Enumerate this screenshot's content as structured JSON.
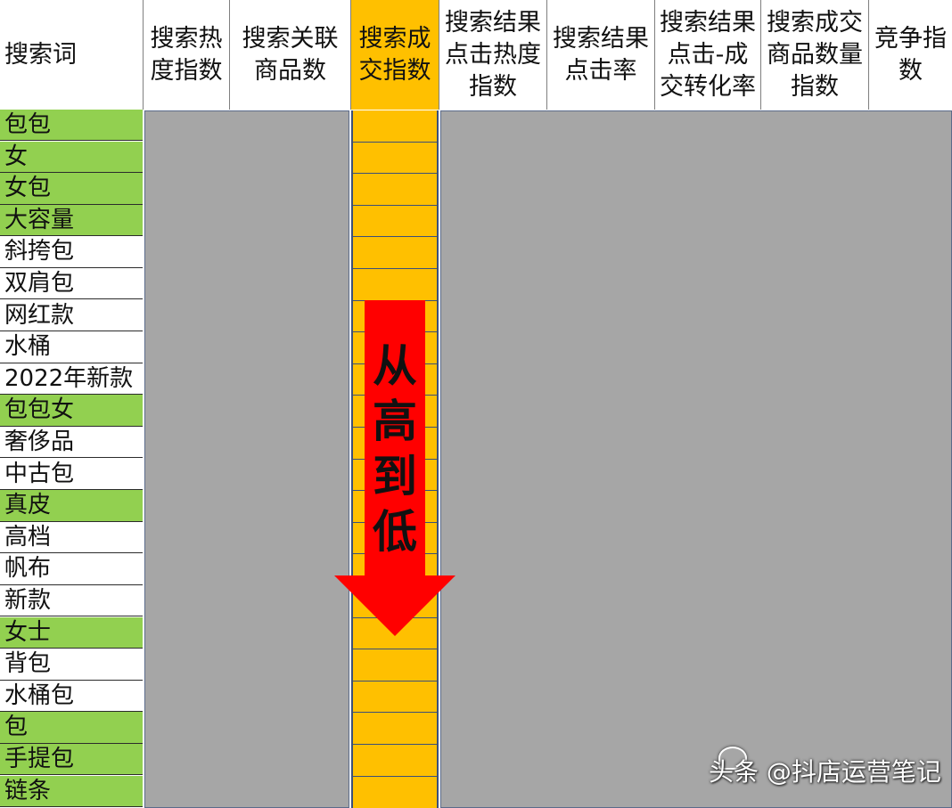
{
  "header": {
    "keyword": "搜索词",
    "columns": [
      "搜索热\n度指数",
      "搜索关联\n商品数",
      "搜索成\n交指数",
      "搜索结果\n点击热度\n指数",
      "搜索结果\n点击率",
      "搜索结果\n点击-成\n交转化率",
      "搜索成交\n商品数量\n指数",
      "竞争指\n数"
    ]
  },
  "keywords": [
    {
      "text": "包包",
      "highlight": true
    },
    {
      "text": "女",
      "highlight": true
    },
    {
      "text": "女包",
      "highlight": true
    },
    {
      "text": "大容量",
      "highlight": true
    },
    {
      "text": "斜挎包",
      "highlight": false
    },
    {
      "text": "双肩包",
      "highlight": false
    },
    {
      "text": "网红款",
      "highlight": false
    },
    {
      "text": "水桶",
      "highlight": false
    },
    {
      "text": "2022年新款",
      "highlight": false
    },
    {
      "text": "包包女",
      "highlight": true
    },
    {
      "text": "奢侈品",
      "highlight": false
    },
    {
      "text": "中古包",
      "highlight": false
    },
    {
      "text": "真皮",
      "highlight": true
    },
    {
      "text": "高档",
      "highlight": false
    },
    {
      "text": "帆布",
      "highlight": false
    },
    {
      "text": "新款",
      "highlight": false
    },
    {
      "text": "女士",
      "highlight": true
    },
    {
      "text": "背包",
      "highlight": false
    },
    {
      "text": "水桶包",
      "highlight": false
    },
    {
      "text": "包",
      "highlight": true
    },
    {
      "text": "手提包",
      "highlight": true
    },
    {
      "text": "链条",
      "highlight": true
    }
  ],
  "arrow": {
    "label": "从高到低",
    "color": "#ff0000"
  },
  "watermark": "头条 @抖店运营笔记",
  "colors": {
    "highlight": "#92d050",
    "sorted_column": "#ffc000",
    "data_block": "#a6a6a6"
  }
}
